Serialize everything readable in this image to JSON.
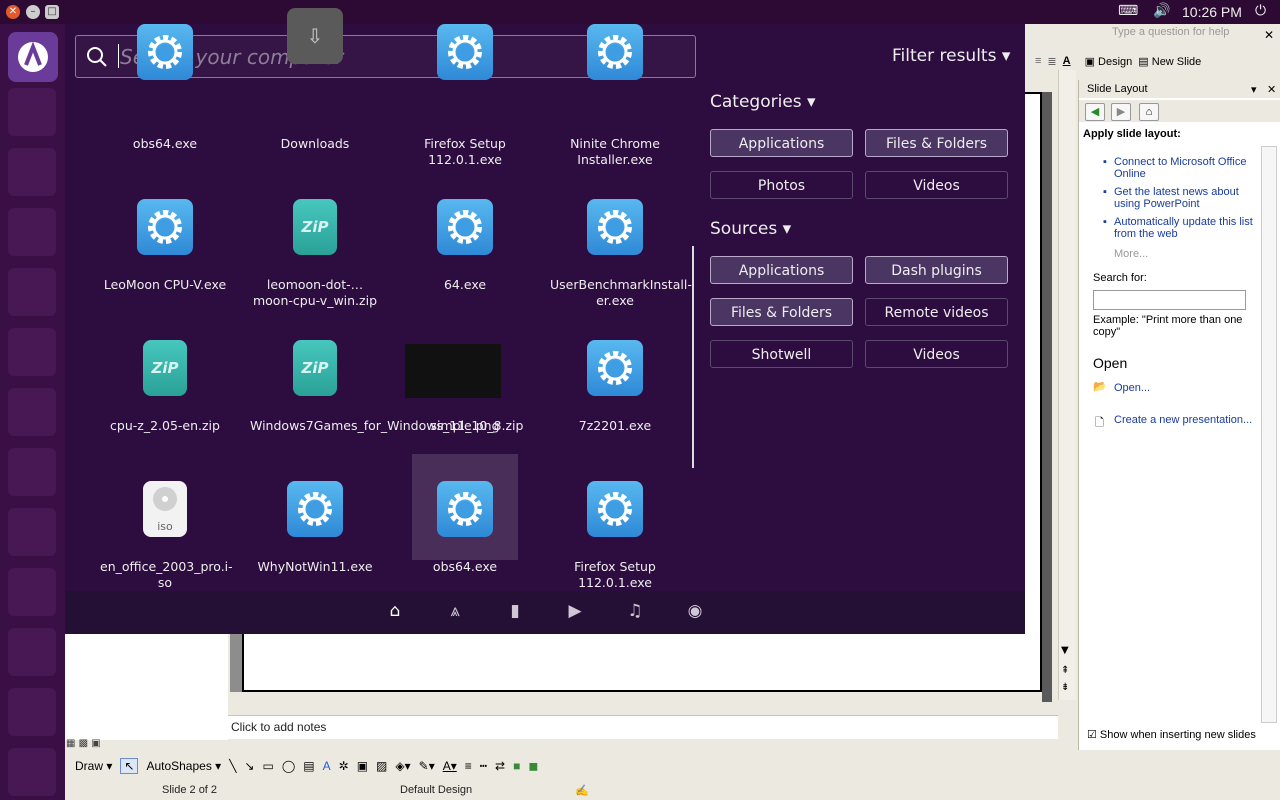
{
  "panel": {
    "time": "10:26 PM"
  },
  "search": {
    "placeholder": "Search your computer"
  },
  "filter": {
    "label": "Filter results",
    "categories_title": "Categories",
    "sources_title": "Sources",
    "categories": [
      {
        "label": "Applications",
        "selected": true
      },
      {
        "label": "Files & Folders",
        "selected": true
      },
      {
        "label": "Photos",
        "selected": false
      },
      {
        "label": "Videos",
        "selected": false
      }
    ],
    "sources": [
      {
        "label": "Applications",
        "selected": true
      },
      {
        "label": "Dash plugins",
        "selected": true
      },
      {
        "label": "Files & Folders",
        "selected": true
      },
      {
        "label": "Remote videos",
        "selected": false
      },
      {
        "label": "Shotwell",
        "selected": false
      },
      {
        "label": "Videos",
        "selected": false
      }
    ]
  },
  "results": [
    {
      "label": "obs64.exe",
      "icon": "gear-icon"
    },
    {
      "label": "Downloads",
      "icon": "downloads-folder-icon"
    },
    {
      "label": "Firefox Setup 112.0.1.exe",
      "icon": "gear-icon"
    },
    {
      "label": "Ninite Chrome Installer.exe",
      "icon": "gear-icon"
    },
    {
      "label": "LeoMoon CPU-V.exe",
      "icon": "gear-icon"
    },
    {
      "label": "leomoon-dot-… moon-cpu-v_win.zip",
      "icon": "zip-icon"
    },
    {
      "label": "64.exe",
      "icon": "gear-icon"
    },
    {
      "label": "UserBenchmarkInstall-er.exe",
      "icon": "gear-icon"
    },
    {
      "label": "cpu-z_2.05-en.zip",
      "icon": "zip-icon"
    },
    {
      "label": "Windows7Games_for_Windows_11_10_8.zip",
      "icon": "zip-icon"
    },
    {
      "label": "simple.png",
      "icon": "image-thumbnail"
    },
    {
      "label": "7z2201.exe",
      "icon": "gear-icon"
    },
    {
      "label": "en_office_2003_pro.i-so",
      "icon": "iso-disc-icon"
    },
    {
      "label": "WhyNotWin11.exe",
      "icon": "gear-icon"
    },
    {
      "label": "obs64.exe",
      "icon": "gear-icon"
    },
    {
      "label": "Firefox Setup 112.0.1.exe",
      "icon": "gear-icon"
    }
  ],
  "icon_text": {
    "zip": "ZiP",
    "iso": "iso"
  },
  "lenses": [
    "home-lens-icon",
    "applications-lens-icon",
    "files-lens-icon",
    "video-lens-icon",
    "music-lens-icon",
    "photo-lens-icon"
  ],
  "ppt": {
    "help_placeholder": "Type a question for help",
    "design_label": "Design",
    "new_slide_label": "New Slide",
    "taskpane_title": "Slide Layout",
    "apply_layout": "Apply slide layout:",
    "links": [
      "Connect to Microsoft Office Online",
      "Get the latest news about using PowerPoint",
      "Automatically update this list from the web"
    ],
    "more": "More...",
    "search_for": "Search for:",
    "example": "Example:  \"Print more than one copy\"",
    "open_heading": "Open",
    "open_link": "Open...",
    "create_link": "Create a new presentation...",
    "show_when_inserting": "Show when inserting new slides",
    "notes": "Click to add notes",
    "draw": "Draw",
    "autoshapes": "AutoShapes",
    "status_slide": "Slide 2 of 2",
    "status_design": "Default Design"
  },
  "colors": {
    "dash_bg": "#2d0c3f",
    "accent": "#4a3563"
  }
}
